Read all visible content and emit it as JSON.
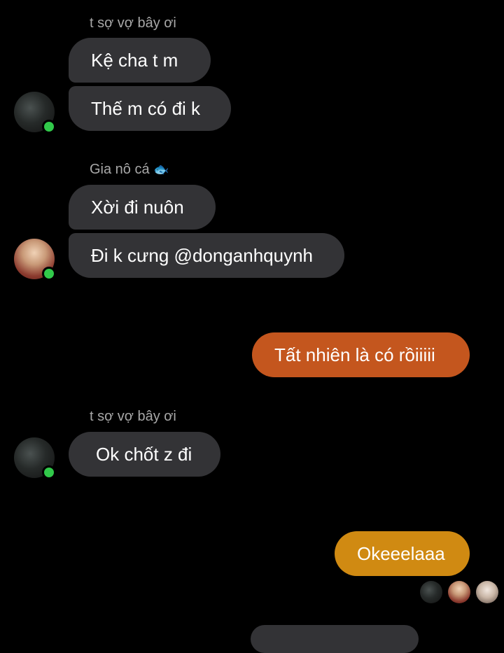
{
  "colors": {
    "background": "#000000",
    "incoming_bubble": "#333336",
    "outgoing_bubble_1": "#c4561e",
    "outgoing_bubble_2": "#d08a12",
    "online_dot": "#31c94a",
    "sender_name": "#a8a8a8"
  },
  "groups": [
    {
      "sender": "t sợ vợ bây ơi",
      "messages": [
        "Kệ cha t m",
        "Thế m có đi k"
      ]
    },
    {
      "sender": "Gia nô cá",
      "sender_emoji_icon": "fish-emoji-icon",
      "messages": [
        "Xời đi nuôn",
        "Đi k cưng @donganhquynh"
      ]
    },
    {
      "sender": "t sợ vợ bây ơi",
      "messages": [
        "Ok chốt z đi"
      ]
    }
  ],
  "outgoing": [
    "Tất nhiên là có rồiiiii",
    "Okeeelaaa"
  ],
  "fish_emoji": "🐟"
}
